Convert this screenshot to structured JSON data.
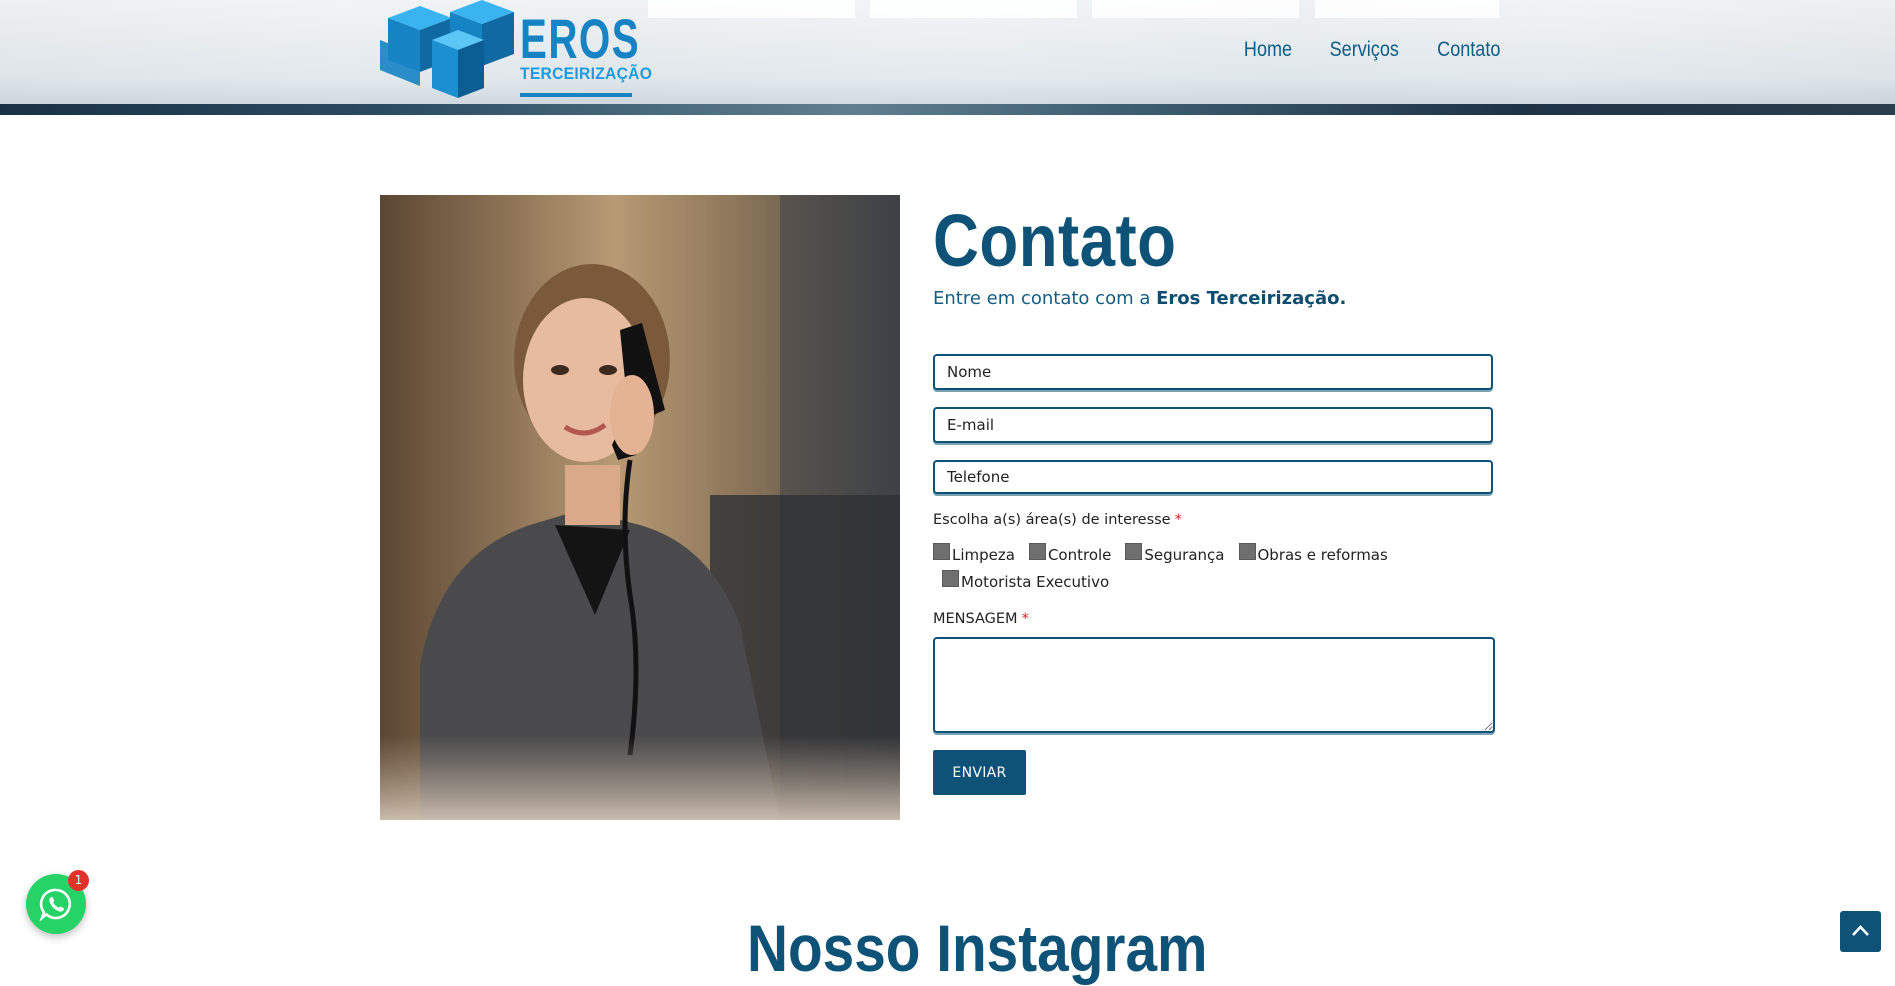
{
  "brand": {
    "logo_word": "EROS",
    "logo_subtitle": "TERCEIRIZAÇÃO",
    "logo_icon": "stacked-cubes-icon",
    "primary_color": "#0e5377",
    "accent_color": "#1583c4"
  },
  "nav": {
    "items": [
      {
        "label": "Home"
      },
      {
        "label": "Serviços"
      },
      {
        "label": "Contato"
      }
    ]
  },
  "contact": {
    "title": "Contato",
    "intro_text": "Entre em contato com a ",
    "intro_brand": "Eros Terceirização.",
    "photo": "woman-on-phone-photo",
    "fields": {
      "name_placeholder": "Nome",
      "email_placeholder": "E-mail",
      "phone_placeholder": "Telefone"
    },
    "interest_label": "Escolha a(s) área(s) de interesse",
    "required_mark": "*",
    "options": [
      {
        "label": "Limpeza",
        "checked": false
      },
      {
        "label": "Controle",
        "checked": false
      },
      {
        "label": "Segurança",
        "checked": false
      },
      {
        "label": "Obras e reformas",
        "checked": false
      },
      {
        "label": "Motorista Executivo",
        "checked": false
      }
    ],
    "message_label": "MENSAGEM",
    "submit_label": "ENVIAR"
  },
  "instagram": {
    "title": "Nosso Instagram"
  },
  "whatsapp": {
    "icon": "whatsapp-icon",
    "badge_count": "1",
    "color": "#25d366"
  },
  "scroll_top": {
    "icon": "chevron-up-icon"
  }
}
